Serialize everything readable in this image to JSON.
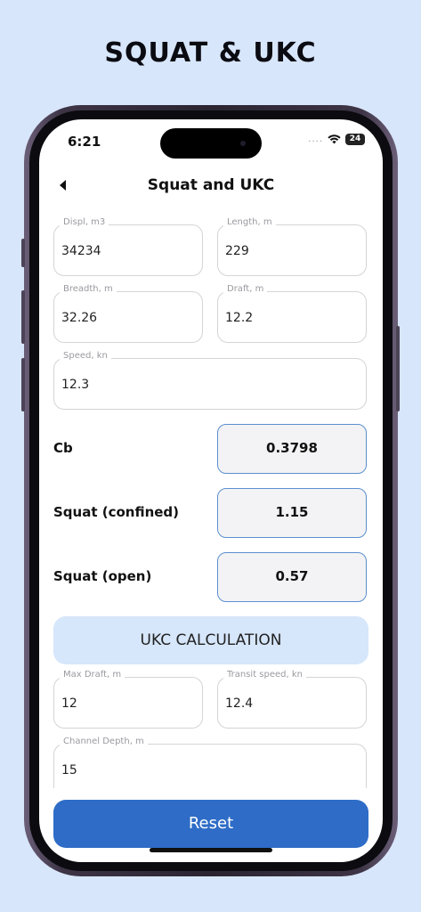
{
  "banner": {
    "title": "SQUAT & UKC"
  },
  "status_bar": {
    "time": "6:21",
    "signal": "....",
    "wifi_icon": "wifi-icon",
    "battery": "24"
  },
  "nav": {
    "back_icon": "back-arrow-icon",
    "title": "Squat and UKC"
  },
  "inputs": {
    "displ": {
      "label": "Displ, m3",
      "value": "34234"
    },
    "length": {
      "label": "Length, m",
      "value": "229"
    },
    "breadth": {
      "label": "Breadth, m",
      "value": "32.26"
    },
    "draft": {
      "label": "Draft, m",
      "value": "12.2"
    },
    "speed": {
      "label": "Speed, kn",
      "value": "12.3"
    }
  },
  "results": {
    "cb": {
      "label": "Cb",
      "value": "0.3798"
    },
    "squat_confined": {
      "label": "Squat (confined)",
      "value": "1.15"
    },
    "squat_open": {
      "label": "Squat (open)",
      "value": "0.57"
    }
  },
  "ukc": {
    "header": "UKC CALCULATION",
    "max_draft": {
      "label": "Max Draft, m",
      "value": "12"
    },
    "transit_speed": {
      "label": "Transit speed, kn",
      "value": "12.4"
    },
    "channel_depth": {
      "label": "Channel Depth, m",
      "value": "15"
    }
  },
  "actions": {
    "reset_label": "Reset"
  },
  "colors": {
    "background": "#d8e6fb",
    "accent": "#2e6cc7",
    "result_border": "#5b8fcf",
    "section_bg": "#d6e6fb"
  }
}
